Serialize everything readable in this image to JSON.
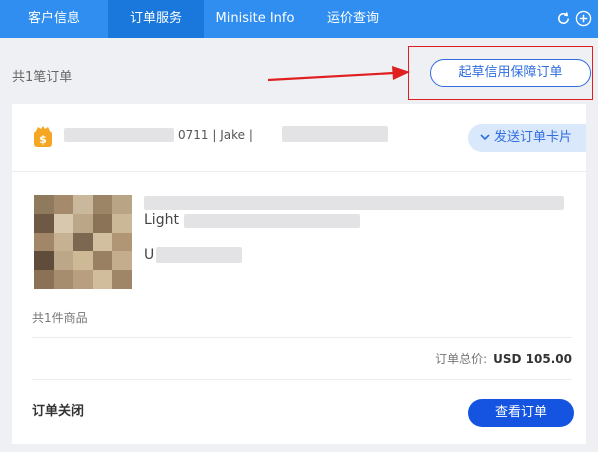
{
  "tabs": [
    {
      "label": "客户信息",
      "active": false
    },
    {
      "label": "订单服务",
      "active": true
    },
    {
      "label": "Minisite Info",
      "active": false
    },
    {
      "label": "运价查询",
      "active": false
    }
  ],
  "header_actions": {
    "refresh_icon": "refresh-icon",
    "add_icon": "plus-circle-icon"
  },
  "order_count_text": "共1笔订单",
  "draft_button_label": "起草信用保障订单",
  "card": {
    "shop_name_visible": "0711 | Jake |",
    "send_card_label": "发送订单卡片",
    "product_title_visible": "Light",
    "product_sub_visible": "U",
    "items_count_text": "共1件商品",
    "total_label": "订单总价:",
    "total_amount": "USD 105.00",
    "status_text": "订单关闭",
    "view_order_label": "查看订单"
  },
  "colors": {
    "tab_bar": "#2f8ef0",
    "tab_active": "#1a78dd",
    "accent_blue": "#2f6de0",
    "primary_button": "#1554e0",
    "highlight_red": "#e02020"
  }
}
